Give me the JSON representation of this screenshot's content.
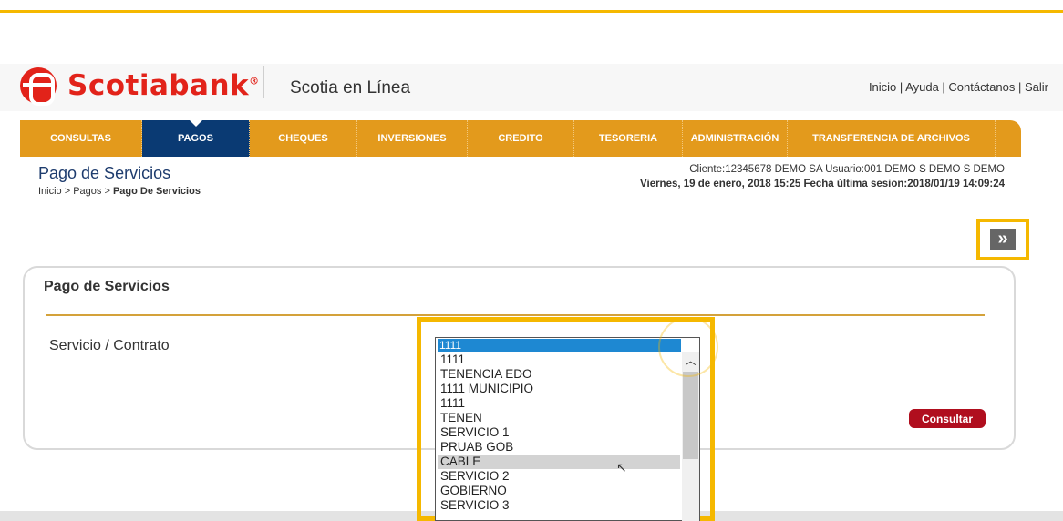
{
  "brand": {
    "name": "Scotiabank",
    "reg": "®",
    "product": "Scotia en Línea"
  },
  "util_links": "Inicio | Ayuda | Contáctanos | Salir",
  "menu": [
    {
      "label": "CONSULTAS",
      "active": false
    },
    {
      "label": "PAGOS",
      "active": true
    },
    {
      "label": "CHEQUES",
      "active": false
    },
    {
      "label": "INVERSIONES",
      "active": false
    },
    {
      "label": "CREDITO",
      "active": false
    },
    {
      "label": "TESORERIA",
      "active": false
    },
    {
      "label": "ADMINISTRACIÓN",
      "active": false
    },
    {
      "label": "TRANSFERENCIA DE ARCHIVOS",
      "active": false
    }
  ],
  "page": {
    "title": "Pago de Servicios",
    "breadcrumb_prefix": "Inicio > Pagos > ",
    "breadcrumb_current": "Pago De Servicios"
  },
  "client": {
    "line1": "Cliente:12345678  DEMO SA    Usuario:001 DEMO S DEMO S DEMO",
    "line2": "Viernes, 19 de enero, 2018 15:25    Fecha última sesion:2018/01/19 14:09:24"
  },
  "forward_icon": "double-chevron-right-icon",
  "panel": {
    "title": "Pago de Servicios",
    "field_label": "Servicio / Contrato",
    "consult_label": "Consultar"
  },
  "select": {
    "selected": "1111",
    "options": [
      "1111",
      "TENENCIA EDO",
      "1111 MUNICIPIO",
      "1111",
      "TENEN",
      "SERVICIO 1",
      "PRUAB GOB",
      "CABLE",
      "SERVICIO 2",
      "GOBIERNO",
      "SERVICIO 3"
    ],
    "hover_index": 7
  },
  "colors": {
    "accent": "#f5b800",
    "menu": "#e39a1c",
    "menu_active": "#0a3a73",
    "brand_red": "#e2231a",
    "button": "#b00e1e"
  }
}
